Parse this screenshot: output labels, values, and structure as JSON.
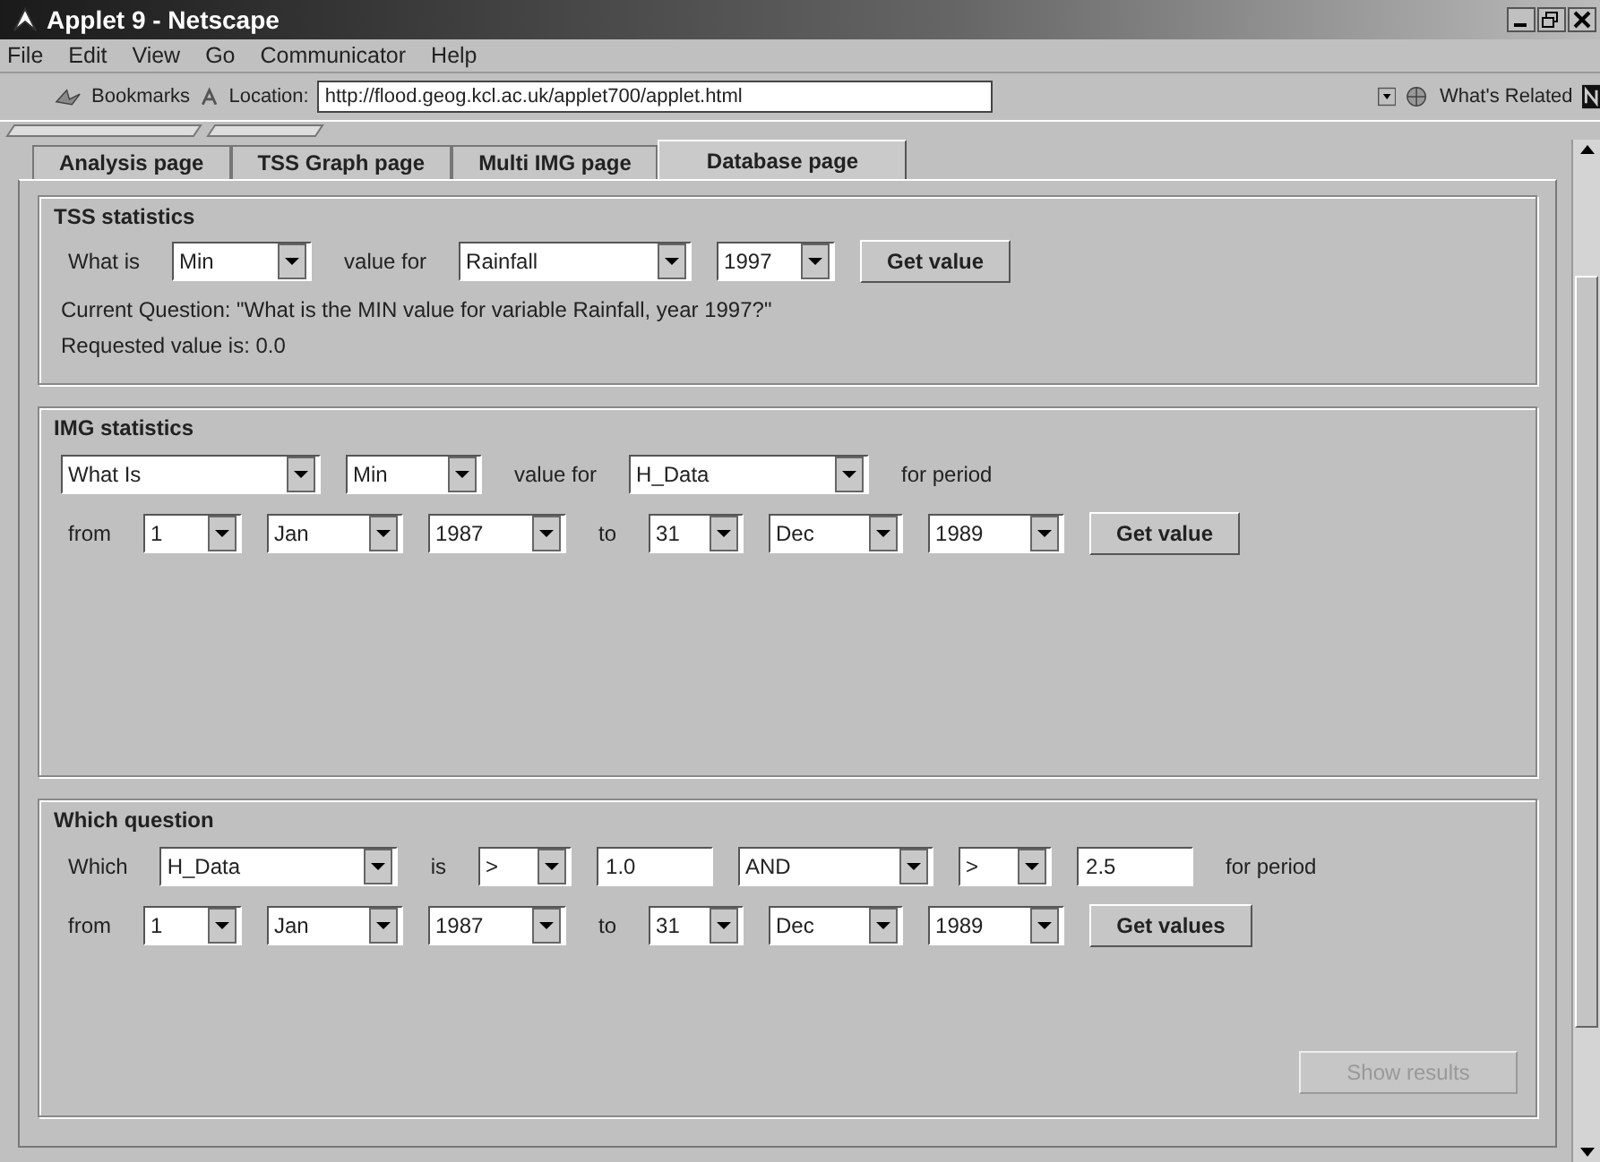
{
  "window": {
    "title": "Applet 9 - Netscape"
  },
  "menu": [
    "File",
    "Edit",
    "View",
    "Go",
    "Communicator",
    "Help"
  ],
  "toolbar": {
    "bookmarks": "Bookmarks",
    "location_label": "Location:",
    "url": "http://flood.geog.kcl.ac.uk/applet700/applet.html",
    "related": "What's Related"
  },
  "tabs": [
    {
      "label": "Analysis page",
      "selected": false
    },
    {
      "label": "TSS Graph page",
      "selected": false
    },
    {
      "label": "Multi IMG page",
      "selected": false
    },
    {
      "label": "Database page",
      "selected": true
    }
  ],
  "panels": [
    {
      "title": "TSS statistics",
      "rows": [
        {
          "items": [
            {
              "kind": "label",
              "text": "What is"
            },
            {
              "kind": "select",
              "value": "Min"
            },
            {
              "kind": "label",
              "text": "value for"
            },
            {
              "kind": "select",
              "value": "Rainfall"
            },
            {
              "kind": "select",
              "value": "1997"
            },
            {
              "kind": "button",
              "text": "Get value",
              "disabled": false
            }
          ]
        }
      ],
      "lines": [
        "Current Question: \"What is the MIN value for variable Rainfall, year 1997?\"",
        "Requested value is: 0.0"
      ]
    },
    {
      "title": "IMG statistics",
      "rows": [
        {
          "items": [
            {
              "kind": "select",
              "value": "What Is"
            },
            {
              "kind": "select",
              "value": "Min"
            },
            {
              "kind": "label",
              "text": "value for"
            },
            {
              "kind": "select",
              "value": "H_Data"
            },
            {
              "kind": "label",
              "text": "for period"
            }
          ]
        },
        {
          "items": [
            {
              "kind": "label",
              "text": "from"
            },
            {
              "kind": "select",
              "value": "1"
            },
            {
              "kind": "select",
              "value": "Jan"
            },
            {
              "kind": "select",
              "value": "1987"
            },
            {
              "kind": "label",
              "text": "to"
            },
            {
              "kind": "select",
              "value": "31"
            },
            {
              "kind": "select",
              "value": "Dec"
            },
            {
              "kind": "select",
              "value": "1989"
            },
            {
              "kind": "button",
              "text": "Get value",
              "disabled": false
            }
          ]
        }
      ]
    },
    {
      "title": "Which question",
      "rows": [
        {
          "items": [
            {
              "kind": "label",
              "text": "Which"
            },
            {
              "kind": "select",
              "value": "H_Data"
            },
            {
              "kind": "label",
              "text": "is"
            },
            {
              "kind": "select",
              "value": ">"
            },
            {
              "kind": "input",
              "value": "1.0"
            },
            {
              "kind": "select",
              "value": "AND"
            },
            {
              "kind": "select",
              "value": ">"
            },
            {
              "kind": "input",
              "value": "2.5"
            },
            {
              "kind": "label",
              "text": "for period"
            }
          ]
        },
        {
          "items": [
            {
              "kind": "label",
              "text": "from"
            },
            {
              "kind": "select",
              "value": "1"
            },
            {
              "kind": "select",
              "value": "Jan"
            },
            {
              "kind": "select",
              "value": "1987"
            },
            {
              "kind": "label",
              "text": "to"
            },
            {
              "kind": "select",
              "value": "31"
            },
            {
              "kind": "select",
              "value": "Dec"
            },
            {
              "kind": "select",
              "value": "1989"
            },
            {
              "kind": "button",
              "text": "Get values",
              "disabled": false
            }
          ]
        }
      ],
      "footer_button": {
        "text": "Show results",
        "disabled": true
      }
    }
  ]
}
